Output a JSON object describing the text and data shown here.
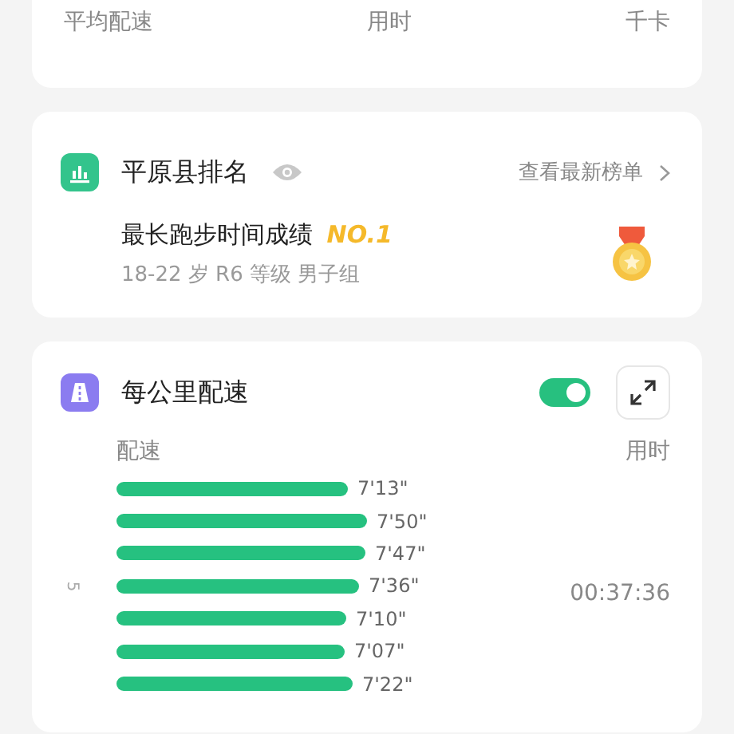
{
  "summary_card": {
    "labels": [
      "平均配速",
      "用时",
      "千卡"
    ]
  },
  "ranking_card": {
    "title": "平原县排名",
    "link": "查看最新榜单",
    "achievement": "最长跑步时间成绩 **NO.1**",
    "detail": "18-22 岁 R6 等级 男子组"
  },
  "pace_card": {
    "title": "每公里配速",
    "toggle_on": true,
    "column_left": "配速",
    "column_right": "用时",
    "km_label": "5",
    "total_time": "00:37:36",
    "rows": [
      {
        "pace": "7'13\""
      },
      {
        "pace": "7'50\""
      },
      {
        "pace": "7'47\""
      },
      {
        "pace": "7'36\""
      },
      {
        "pace": "7'10\""
      },
      {
        "pace": "7'07\""
      },
      {
        "pace": "7'22\""
      }
    ]
  }
}
